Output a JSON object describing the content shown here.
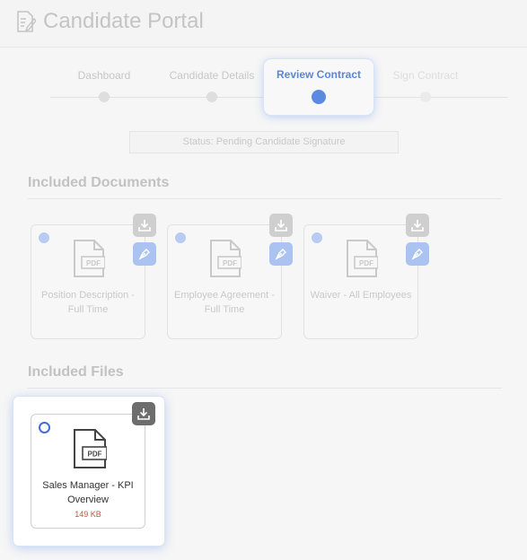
{
  "header": {
    "title": "Candidate Portal",
    "logo_icon": "document-edit-icon"
  },
  "stepper": {
    "steps": [
      {
        "label": "Dashboard",
        "state": "done"
      },
      {
        "label": "Candidate Details",
        "state": "done"
      },
      {
        "label": "Review Contract",
        "state": "active"
      },
      {
        "label": "Sign Contract",
        "state": "pending"
      }
    ],
    "accent": "#5b8be0"
  },
  "status": {
    "text": "Status: Pending Candidate Signature"
  },
  "documents": {
    "title": "Included Documents",
    "items": [
      {
        "name": "Position Description - Full Time",
        "icon": "pdf-file-icon"
      },
      {
        "name": "Employee Agreement - Full Time",
        "icon": "pdf-file-icon"
      },
      {
        "name": "Waiver - All Employees",
        "icon": "pdf-file-icon"
      }
    ]
  },
  "files": {
    "title": "Included Files",
    "items": [
      {
        "name": "Sales Manager - KPI Overview",
        "size": "149 KB",
        "icon": "pdf-file-icon"
      }
    ]
  },
  "pdf_label": "PDF"
}
